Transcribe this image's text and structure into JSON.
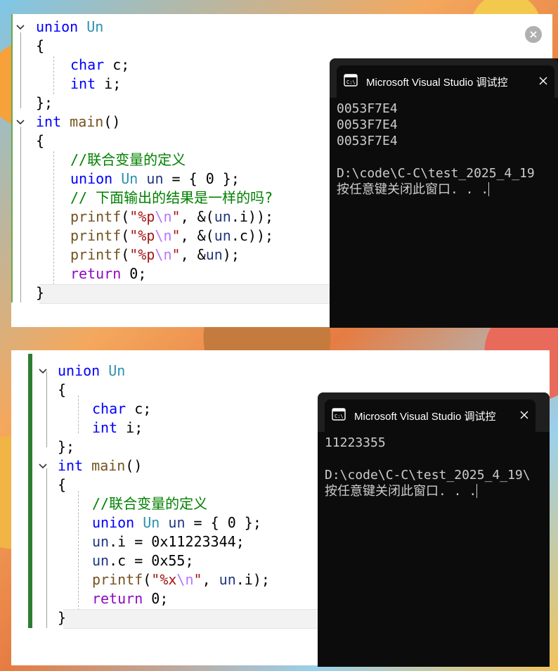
{
  "editor1": {
    "lines": {
      "l1_kw": "union",
      "l1_type": "Un",
      "l2": "{",
      "l3_kw": "char",
      "l3_rest": " c;",
      "l4_kw": "int",
      "l4_rest": " i;",
      "l5": "};",
      "l6_kw": "int",
      "l6_fn": "main",
      "l6_rest": "()",
      "l7": "{",
      "l8_cmt": "//联合变量的定义",
      "l9_kw": "union",
      "l9_type": "Un",
      "l9_var": "un",
      "l9_rest": " = { 0 };",
      "l10_cmt": "// 下面输出的结果是一样的吗?",
      "l11_fn": "printf",
      "l11_a": "(",
      "l11_str1": "\"%p",
      "l11_esc": "\\n",
      "l11_str2": "\"",
      "l11_b": ", &(",
      "l11_var": "un",
      "l11_c": ".i));",
      "l12_fn": "printf",
      "l12_a": "(",
      "l12_str1": "\"%p",
      "l12_esc": "\\n",
      "l12_str2": "\"",
      "l12_b": ", &(",
      "l12_var": "un",
      "l12_c": ".c));",
      "l13_fn": "printf",
      "l13_a": "(",
      "l13_str1": "\"%p",
      "l13_esc": "\\n",
      "l13_str2": "\"",
      "l13_b": ", &",
      "l13_var": "un",
      "l13_c": ");",
      "l14_kw": "return",
      "l14_rest": " 0;",
      "l15": "}"
    }
  },
  "console1": {
    "title": "Microsoft Visual Studio 调试控",
    "output": "0053F7E4\n0053F7E4\n0053F7E4\n\nD:\\code\\C-C\\test_2025_4_19\n按任意键关闭此窗口. . ."
  },
  "editor2": {
    "lines": {
      "l1_kw": "union",
      "l1_type": "Un",
      "l2": "{",
      "l3_kw": "char",
      "l3_rest": " c;",
      "l4_kw": "int",
      "l4_rest": " i;",
      "l5": "};",
      "l6_kw": "int",
      "l6_fn": "main",
      "l6_rest": "()",
      "l7": "{",
      "l8_cmt": "//联合变量的定义",
      "l9_kw": "union",
      "l9_type": "Un",
      "l9_var": "un",
      "l9_rest": " = { 0 };",
      "l10_var": "un",
      "l10_rest": ".i = 0x11223344;",
      "l11_var": "un",
      "l11_rest": ".c = 0x55;",
      "l12_fn": "printf",
      "l12_a": "(",
      "l12_str1": "\"%x",
      "l12_esc": "\\n",
      "l12_str2": "\"",
      "l12_b": ", ",
      "l12_var": "un",
      "l12_c": ".i);",
      "l13_kw": "return",
      "l13_rest": " 0;",
      "l14": "}"
    }
  },
  "console2": {
    "title": "Microsoft Visual Studio 调试控",
    "output": "11223355\n\nD:\\code\\C-C\\test_2025_4_19\\\n按任意键关闭此窗口. . ."
  },
  "icons": {
    "fold": "chevron-down-icon",
    "terminal": "terminal-icon",
    "close": "close-icon"
  },
  "colors": {
    "keyword": "#0000ff",
    "control_keyword": "#8f08c4",
    "type": "#2b91af",
    "function": "#74531f",
    "string": "#a31515",
    "escape": "#b776fb",
    "comment": "#008000",
    "variable": "#1f377f",
    "console_bg": "#0c0c0c"
  }
}
